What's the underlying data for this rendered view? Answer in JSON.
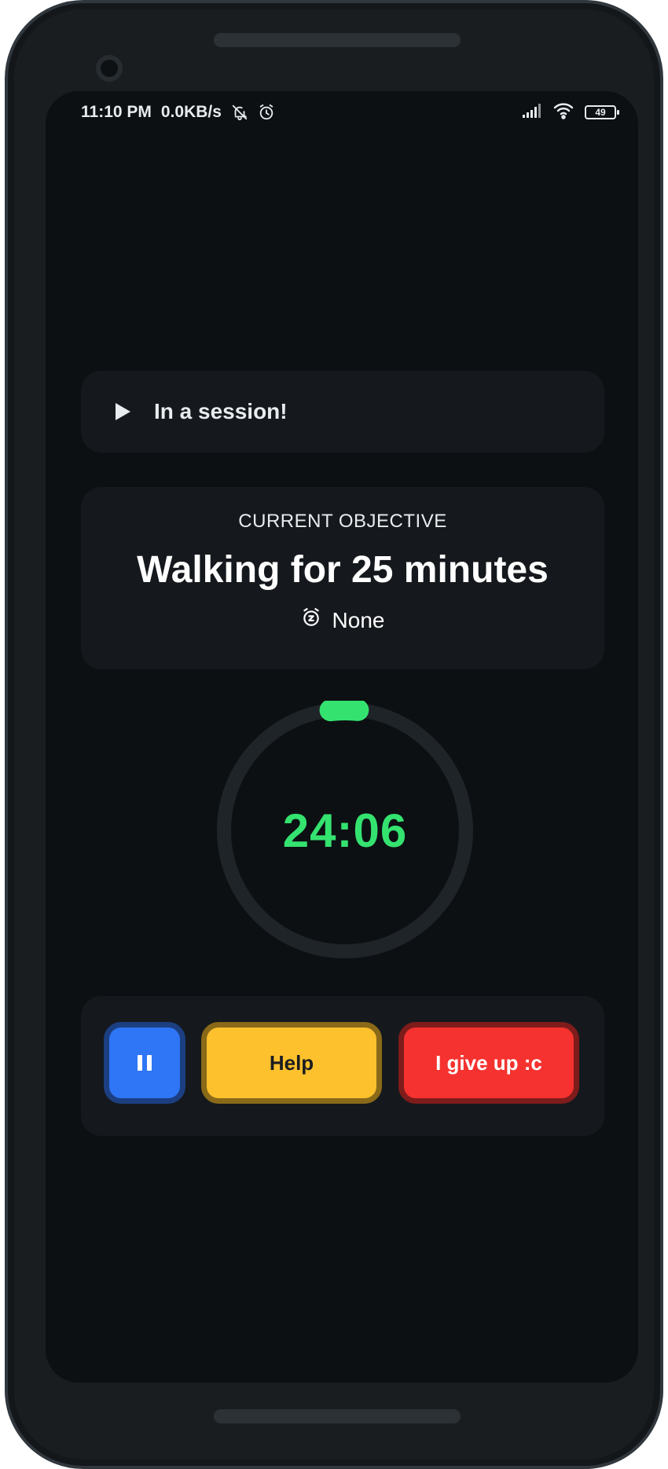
{
  "status_bar": {
    "time": "11:10 PM",
    "net_speed": "0.0KB/s",
    "icons": [
      "bell-off-icon",
      "alarm-icon",
      "signal-icon",
      "wifi-icon"
    ],
    "battery": "49"
  },
  "session": {
    "icon": "play-icon",
    "label": "In a session!"
  },
  "objective": {
    "kicker": "CURRENT OBJECTIVE",
    "title": "Walking for 25 minutes",
    "snooze_icon": "snooze-alarm-icon",
    "snooze_value": "None"
  },
  "timer": {
    "display": "24:06",
    "progress": 0.036,
    "ring_color": "#34e36f",
    "track_color": "#1f2429"
  },
  "controls": {
    "pause_icon": "pause-icon",
    "help_label": "Help",
    "give_up_label": "I give up :c"
  },
  "colors": {
    "background": "#0d1013",
    "card": "#15191d",
    "accent_green": "#34e36f",
    "pause_blue": "#2e76f5",
    "help_yellow": "#fcc12d",
    "give_up_red": "#f5322f"
  }
}
